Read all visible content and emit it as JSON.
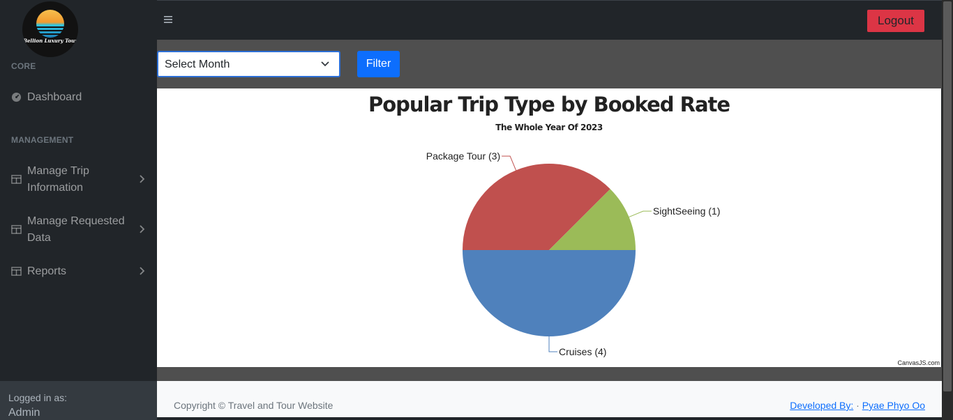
{
  "brand": {
    "logo_text": "Bellion Luxury Tour"
  },
  "sidebar": {
    "core_heading": "CORE",
    "management_heading": "MANAGEMENT",
    "items": [
      {
        "label": "Dashboard",
        "icon": "dashboard-icon"
      },
      {
        "label": "Manage Trip Information",
        "icon": "columns-icon"
      },
      {
        "label": "Manage Requested Data",
        "icon": "columns-icon"
      },
      {
        "label": "Reports",
        "icon": "columns-icon"
      }
    ],
    "footer": {
      "logged_in_label": "Logged in as:",
      "user": "Admin"
    }
  },
  "header": {
    "menu_icon": "hamburger-icon",
    "logout_label": "Logout"
  },
  "filter": {
    "select_value": "Select Month",
    "button_label": "Filter"
  },
  "chart_data": {
    "type": "pie",
    "title": "Popular Trip Type by Booked Rate",
    "subtitle": "The Whole Year Of 2023",
    "slices": [
      {
        "label": "Package Tour",
        "value": 3,
        "color": "#c0504e"
      },
      {
        "label": "SightSeeing",
        "value": 1,
        "color": "#9bbb58"
      },
      {
        "label": "Cruises",
        "value": 4,
        "color": "#4f81bc"
      }
    ],
    "credit": "CanvasJS.com"
  },
  "footer": {
    "copyright": "Copyright © Travel and Tour Website",
    "developed_by": "Developed By:",
    "separator": "·",
    "developer": "Pyae Phyo Oo"
  },
  "colors": {
    "danger": "#dc3545",
    "primary": "#0d6efd",
    "sidebar": "#212529"
  }
}
